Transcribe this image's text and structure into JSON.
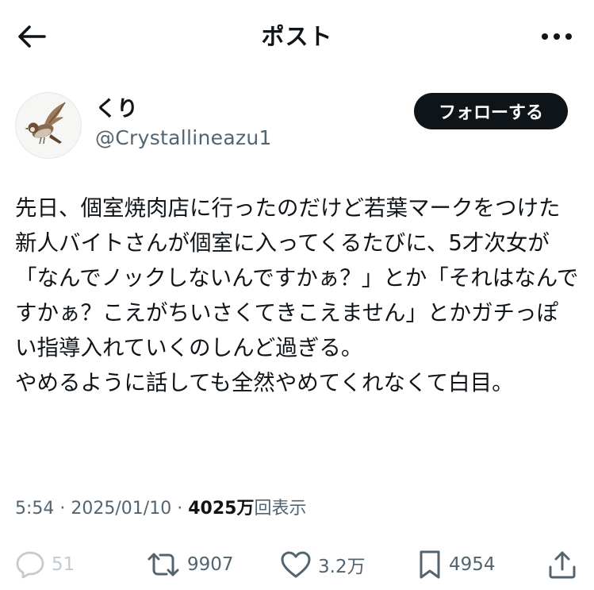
{
  "header": {
    "title": "ポスト",
    "back_icon": "arrow-left-icon",
    "more_icon": "more-horizontal-icon"
  },
  "author": {
    "display_name": "くり",
    "handle": "@Crystallineazu1",
    "avatar_icon": "sparrow-bird-avatar",
    "follow_label": "フォローする"
  },
  "post": {
    "text": "先日、個室焼肉店に行ったのだけど若葉マークをつけた新人バイトさんが個室に入ってくるたびに、5才次女が「なんでノックしないんですかぁ？」とか「それはなんですかぁ？こえがちいさくてきこえません」とかガチっぽい指導入れていくのしんど過ぎる。\nやめるように話しても全然やめてくれなくて白目。"
  },
  "meta": {
    "time": "5:54",
    "separator": "·",
    "date": "2025/01/10",
    "views_count": "4025万",
    "views_label": "回表示"
  },
  "actions": {
    "reply_count": "51",
    "repost_count": "9907",
    "like_count": "3.2万",
    "bookmark_count": "4954"
  },
  "colors": {
    "text_primary": "#0f1419",
    "text_secondary": "#536471",
    "follow_bg": "#0f1419",
    "reply_muted": "#c3cbd1"
  }
}
